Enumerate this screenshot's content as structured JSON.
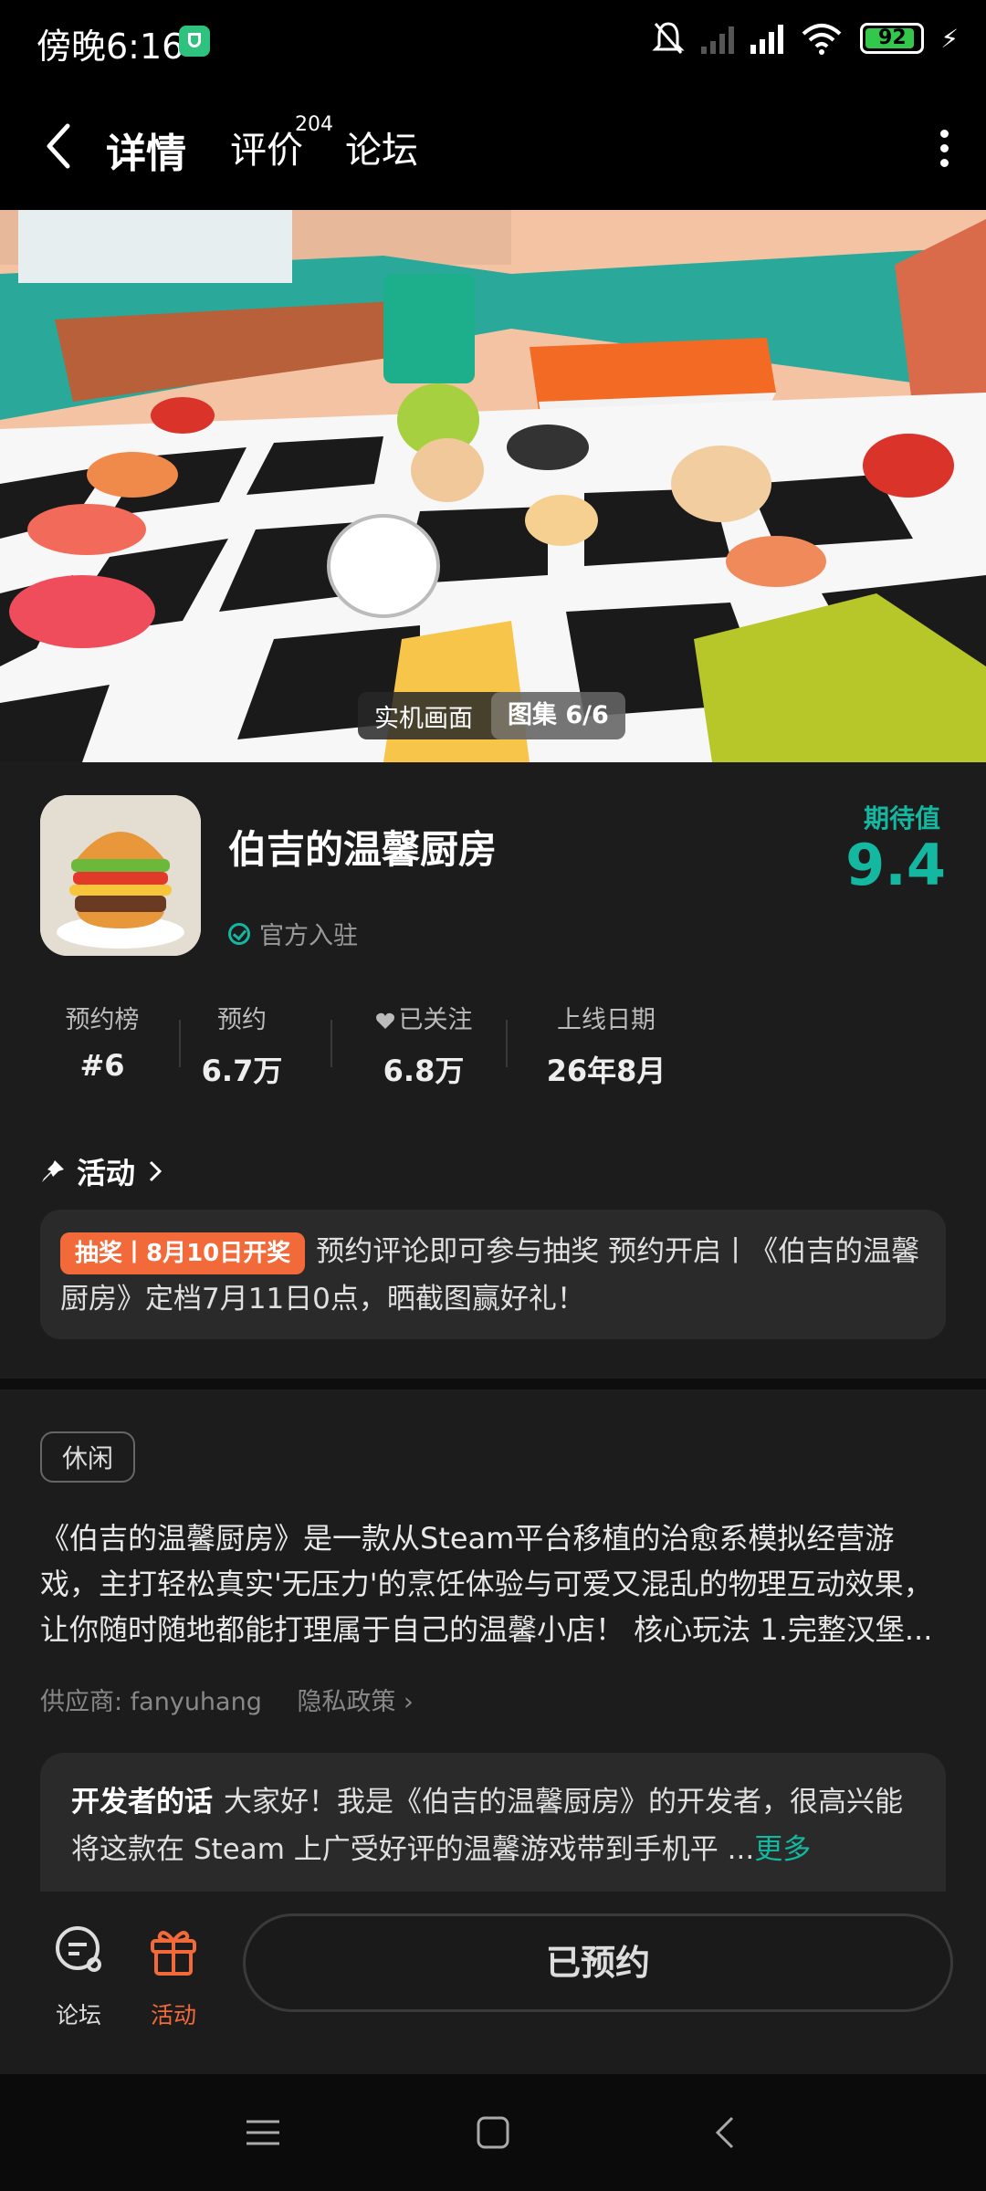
{
  "status_bar": {
    "time": "傍晚6:16",
    "battery": "92"
  },
  "nav": {
    "tabs": [
      "详情",
      "评价",
      "论坛"
    ],
    "review_count": "204"
  },
  "hero": {
    "caption_left": "实机画面",
    "caption_right": "图集 6/6"
  },
  "app": {
    "title": "伯吉的温馨厨房",
    "official_label": "官方入驻",
    "score_label": "期待值",
    "score": "9.4",
    "stats": [
      {
        "key": "预约榜",
        "value": "#6"
      },
      {
        "key": "预约",
        "value": "6.7万"
      },
      {
        "key": "已关注",
        "value": "6.8万"
      },
      {
        "key": "上线日期",
        "value": "26年8月"
      }
    ]
  },
  "activity": {
    "heading": "活动",
    "pill": "抽奖丨8月10日开奖",
    "text": "预约评论即可参与抽奖 预约开启丨《伯吉的温馨厨房》定档7月11日0点，晒截图赢好礼！"
  },
  "description": {
    "tag": "休闲",
    "body": "《伯吉的温馨厨房》是一款从Steam平台移植的治愈系模拟经营游戏，主打轻松真实'无压力'的烹饪体验与可爱又混乱的物理互动效果，让你随时随地都能打理属于自己的温馨小店！ 核心玩法 1.完整汉堡...",
    "vendor": "供应商: fanyuhang",
    "privacy": "隐私政策"
  },
  "developer": {
    "label": "开发者的话",
    "text": "大家好！我是《伯吉的温馨厨房》的开发者，很高兴能将这款在 Steam 上广受好评的温馨游戏带到手机平 ...",
    "more": "更多"
  },
  "bottom": {
    "forum": "论坛",
    "activity": "活动",
    "reserve": "已预约"
  },
  "colors": {
    "accent": "#14b8a0",
    "orange": "#f26a3a"
  }
}
